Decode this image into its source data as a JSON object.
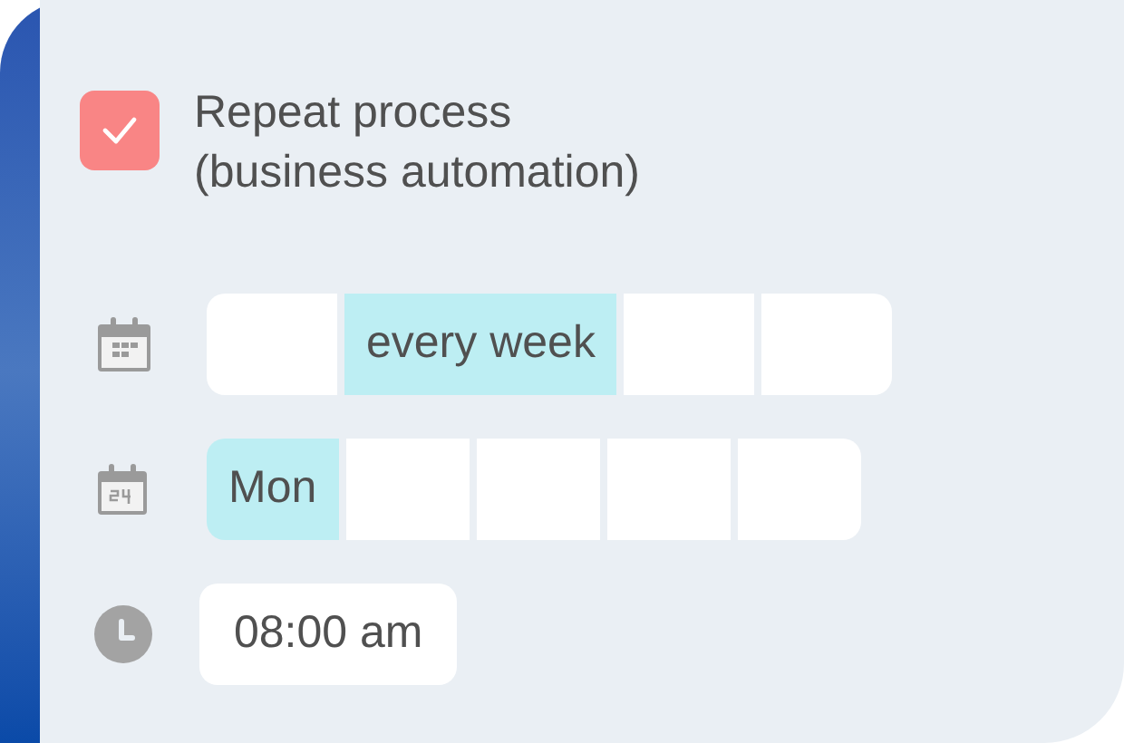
{
  "repeat": {
    "checked": true,
    "label": "Repeat process\n(business automation)"
  },
  "frequency": [
    {
      "selected": false
    },
    {
      "selected": true,
      "label": "every week"
    },
    {
      "selected": false
    },
    {
      "selected": false
    }
  ],
  "weekdays": [
    {
      "selected": true,
      "label": "Mon"
    },
    {
      "selected": false
    },
    {
      "selected": false
    },
    {
      "selected": false
    },
    {
      "selected": false
    }
  ],
  "time": {
    "value": "08:00 am"
  }
}
